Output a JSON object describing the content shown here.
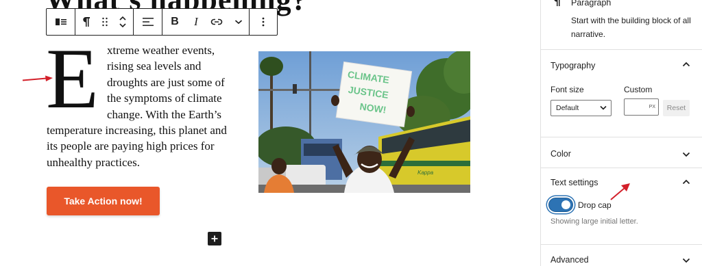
{
  "editor": {
    "heading_partial": "What's happening?",
    "paragraph": {
      "drop_cap": "E",
      "text": "xtreme weather events, rising sea levels and droughts are just some of the symptoms of climate change. With the Earth’s temperature increasing, this planet and its people are paying high prices for unhealthy practices."
    },
    "button_label": "Take Action now!",
    "image": {
      "sign_line1": "CLIMATE",
      "sign_line2": "JUSTICE",
      "sign_line3": "NOW!",
      "bus_text": "Kappa"
    }
  },
  "toolbar": {
    "icons": [
      "block-type-icon",
      "paragraph-icon",
      "drag-handle-icon",
      "move-up-down-icon",
      "align-icon",
      "bold-icon",
      "italic-icon",
      "link-icon",
      "more-rich-text-icon",
      "options-icon"
    ],
    "bold": "B",
    "italic": "I"
  },
  "sidebar": {
    "block_card": {
      "title": "Paragraph",
      "description": "Start with the building block of all narrative."
    },
    "typography": {
      "title": "Typography",
      "font_size_label": "Font size",
      "custom_label": "Custom",
      "font_size_value": "Default",
      "custom_value": "",
      "unit": "PX",
      "reset_label": "Reset"
    },
    "color": {
      "title": "Color"
    },
    "text_settings": {
      "title": "Text settings",
      "drop_cap_label": "Drop cap",
      "drop_cap_enabled": true,
      "drop_cap_help": "Showing large initial letter."
    },
    "advanced": {
      "title": "Advanced"
    }
  },
  "colors": {
    "accent": "#2d73b4",
    "button": "#e9572a",
    "annotation_arrow": "#d3202a",
    "text": "#1e1e1e"
  }
}
